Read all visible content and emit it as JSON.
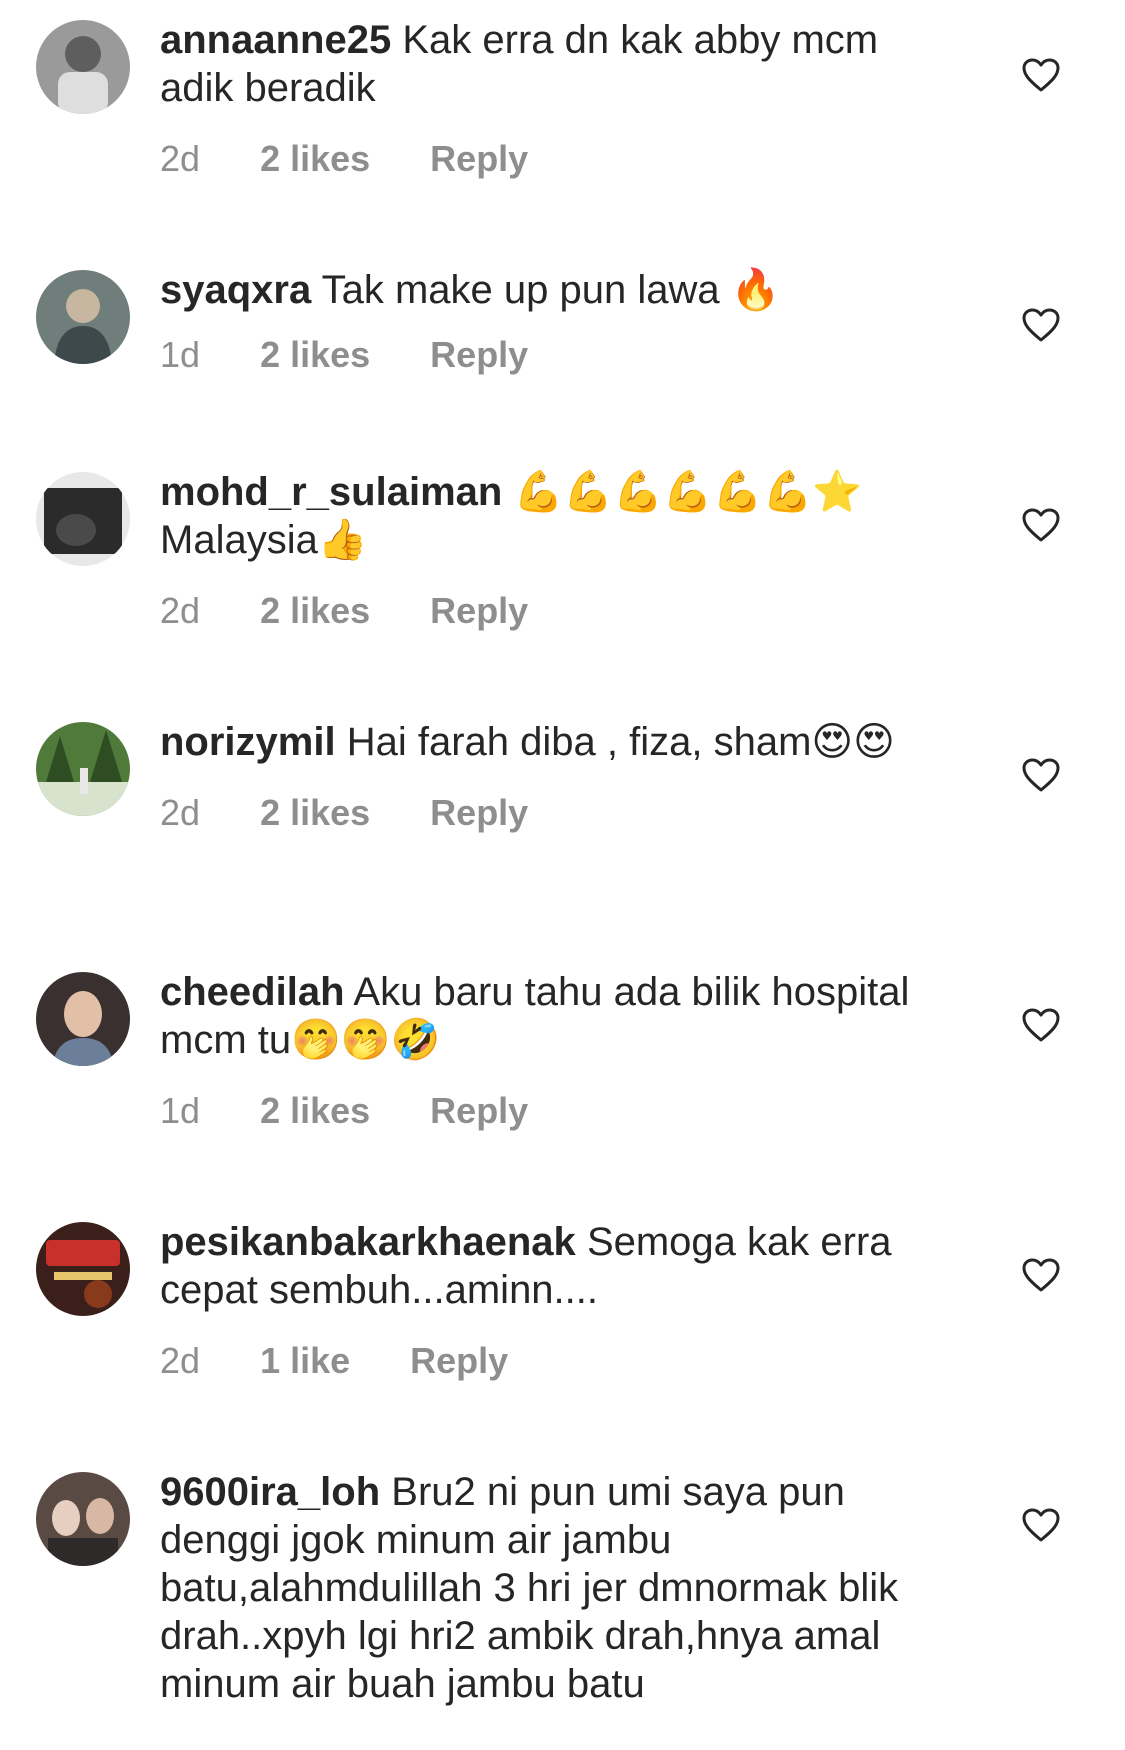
{
  "comments": [
    {
      "username": "annaanne25",
      "text": "Kak erra dn kak abby mcm adik beradik",
      "time": "2d",
      "likes": "2 likes",
      "reply": "Reply",
      "avatar_colors": [
        "#9a9a9a",
        "#dedede",
        "#5e5e5e"
      ]
    },
    {
      "username": "syaqxra",
      "text": "Tak make up pun lawa 🔥",
      "time": "1d",
      "likes": "2 likes",
      "reply": "Reply",
      "avatar_colors": [
        "#6f7d7b",
        "#c7b7a0",
        "#3d4a4c"
      ]
    },
    {
      "username": "mohd_r_sulaiman",
      "text": "💪💪💪💪💪💪⭐ Malaysia👍",
      "time": "2d",
      "likes": "2 likes",
      "reply": "Reply",
      "avatar_colors": [
        "#2b2b2b",
        "#e8e8e8",
        "#4a4a4a"
      ]
    },
    {
      "username": "norizymil",
      "text": "Hai farah diba , fiza, sham😍😍",
      "time": "2d",
      "likes": "2 likes",
      "reply": "Reply",
      "avatar_colors": [
        "#4f7a3a",
        "#d7e3cc",
        "#2f4d22"
      ]
    },
    {
      "username": "cheedilah",
      "text": "Aku baru tahu ada bilik hospital mcm tu🤭🤭🤣",
      "time": "1d",
      "likes": "2 likes",
      "reply": "Reply",
      "avatar_colors": [
        "#3a3030",
        "#e2c0a8",
        "#6b7f9a"
      ]
    },
    {
      "username": "pesikanbakarkhaenak",
      "text": "Semoga kak erra cepat sembuh...aminn....",
      "time": "2d",
      "likes": "1 like",
      "reply": "Reply",
      "avatar_colors": [
        "#3b1f1a",
        "#c9302c",
        "#e8c46a"
      ]
    },
    {
      "username": "9600ira_loh",
      "text": "Bru2 ni pun umi saya pun denggi jgok minum air jambu batu,alahmdulillah 3 hri jer dmnormak blik drah..xpyh lgi hri2 ambik drah,hnya amal minum air buah jambu batu",
      "time": "",
      "likes": "",
      "reply": "",
      "avatar_colors": [
        "#5a4a44",
        "#e6cfc0",
        "#2e2a2a"
      ]
    }
  ],
  "icons": {
    "heart": "heart-outline-icon",
    "heart_color": "#262626"
  }
}
